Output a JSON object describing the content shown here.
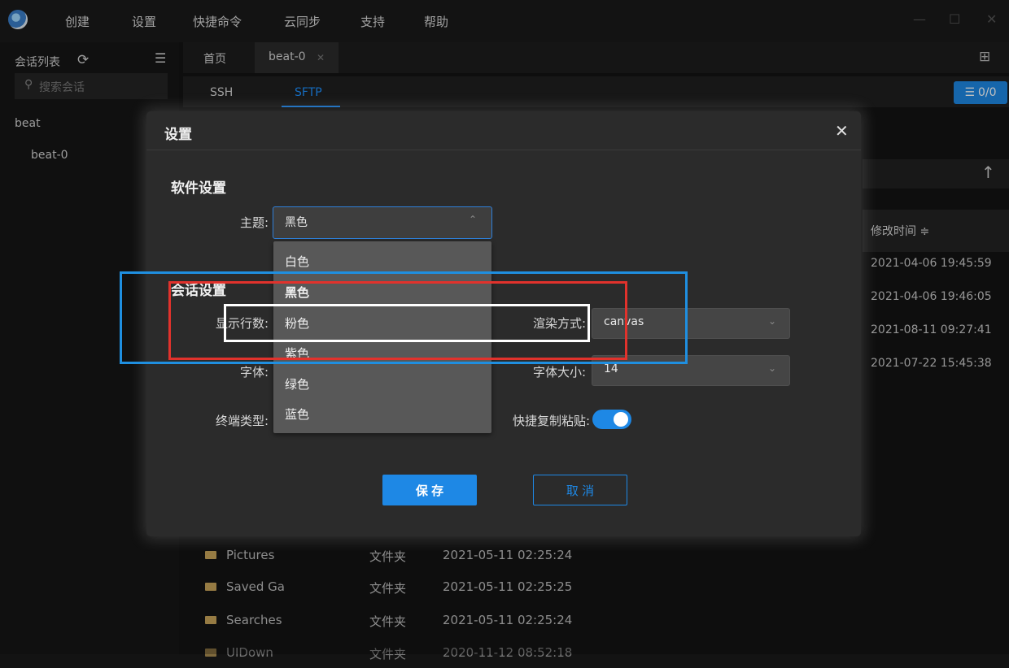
{
  "menubar": {
    "items": [
      "创建",
      "设置",
      "快捷命令",
      "云同步",
      "支持",
      "帮助"
    ],
    "window_controls": [
      "—",
      "☐",
      "✕"
    ]
  },
  "sidebar": {
    "title": "会话列表",
    "search_placeholder": "搜索会话",
    "tree": [
      "beat",
      "beat-0"
    ]
  },
  "tabs": {
    "home": "首页",
    "session": "beat-0",
    "close": "✕"
  },
  "subtabs": {
    "ssh": "SSH",
    "sftp": "SFTP"
  },
  "queue": {
    "label": "0/0"
  },
  "remote": {
    "column_header": "修改时间 ≑",
    "times": [
      "2021-04-06 19:45:59",
      "2021-04-06 19:46:05",
      "2021-08-11 09:27:41",
      "2021-07-22 15:45:38"
    ]
  },
  "files": [
    {
      "name": "Pictures",
      "type": "文件夹",
      "date": "2021-05-11 02:25:24"
    },
    {
      "name": "Saved Ga",
      "type": "文件夹",
      "date": "2021-05-11 02:25:25"
    },
    {
      "name": "Searches",
      "type": "文件夹",
      "date": "2021-05-11 02:25:24"
    },
    {
      "name": "UIDown",
      "type": "文件夹",
      "date": "2020-11-12 08:52:18"
    }
  ],
  "dialog": {
    "title": "设置",
    "close": "✕",
    "software_section": "软件设置",
    "session_section": "会话设置",
    "theme_label": "主题:",
    "theme_value": "黑色",
    "theme_options": [
      "白色",
      "黑色",
      "粉色",
      "紫色",
      "绿色",
      "蓝色"
    ],
    "theme_selected_index": 1,
    "rows_label": "显示行数:",
    "render_label": "渲染方式:",
    "render_value": "canvas",
    "font_label": "字体:",
    "font_size_label": "字体大小:",
    "font_size_value": "14",
    "terminal_label": "终端类型:",
    "quick_copy_label": "快捷复制粘贴:",
    "quick_copy_on": true,
    "save": "保 存",
    "cancel": "取 消"
  },
  "colors": {
    "accent": "#1e88e5",
    "annotation_blue": "#1f8fe0",
    "annotation_red": "#e1322c",
    "annotation_white": "#ffffff"
  }
}
